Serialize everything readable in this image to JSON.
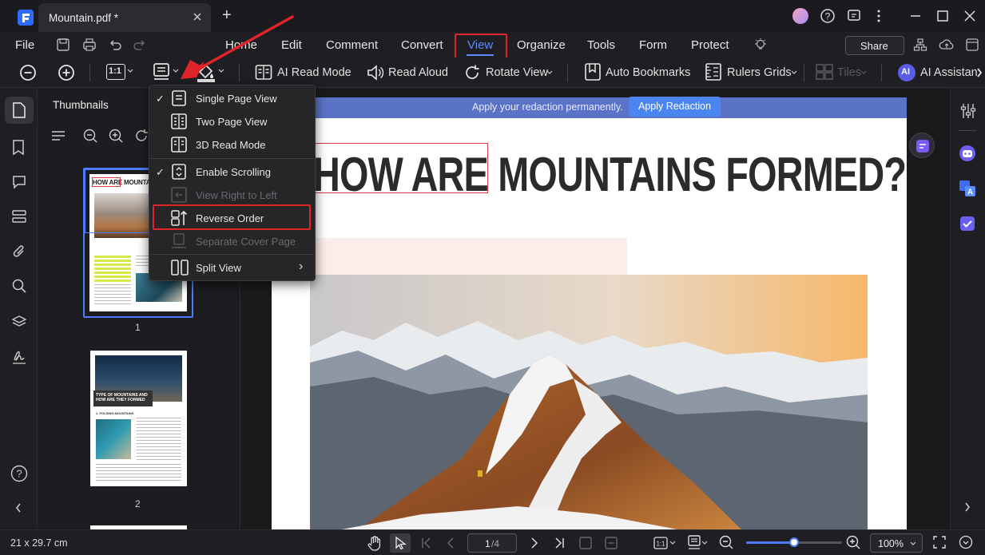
{
  "window": {
    "tab_title": "Mountain.pdf *",
    "new_tab": "+"
  },
  "menu": {
    "file": "File",
    "tabs": [
      "Home",
      "Edit",
      "Comment",
      "Convert",
      "View",
      "Organize",
      "Tools",
      "Form",
      "Protect"
    ],
    "active_tab": "View",
    "share": "Share"
  },
  "toolbar": {
    "zoom_ratio": "1:1",
    "ai_read_mode": "AI Read Mode",
    "read_aloud": "Read Aloud",
    "rotate_view": "Rotate View",
    "auto_bookmarks": "Auto Bookmarks",
    "rulers": "Rulers",
    "grids": "Grids",
    "tiles": "Tiles",
    "ai_badge": "AI",
    "ai_assistant": "AI Assistan"
  },
  "page_display_menu": {
    "items": [
      {
        "label": "Single Page View",
        "checked": true,
        "enabled": true
      },
      {
        "label": "Two Page View",
        "checked": false,
        "enabled": true
      },
      {
        "label": "3D Read Mode",
        "checked": false,
        "enabled": true
      },
      {
        "label": "Enable Scrolling",
        "checked": true,
        "enabled": true
      },
      {
        "label": "View Right to Left",
        "checked": false,
        "enabled": false
      },
      {
        "label": "Reverse Order",
        "checked": false,
        "enabled": true,
        "highlighted": true
      },
      {
        "label": "Separate Cover Page",
        "checked": false,
        "enabled": false
      },
      {
        "label": "Split View",
        "checked": false,
        "enabled": true,
        "submenu": true
      }
    ],
    "check_glyph": "✓",
    "submenu_glyph": "›"
  },
  "thumbnails": {
    "title": "Thumbnails",
    "pages": [
      {
        "number": "1",
        "heading": "HOW ARE MOUNTAIN"
      },
      {
        "number": "2",
        "heading": "TYPE OF MOUNTAINS AND HOW ARE THEY FORMED",
        "subheading": "1. FOLDING MOUNTAINS"
      }
    ]
  },
  "document": {
    "banner_text": "Apply your redaction permanently.",
    "apply_button": "Apply Redaction",
    "heading": "HOW ARE MOUNTAINS FORMED?"
  },
  "status": {
    "page_size": "21 x 29.7 cm",
    "page_current": "1",
    "page_total": "/4",
    "zoom": "100%",
    "zoom_level": 0.5
  },
  "colors": {
    "accent": "#5b8cff",
    "highlight": "#e0242c",
    "banner": "#5a73c7"
  }
}
